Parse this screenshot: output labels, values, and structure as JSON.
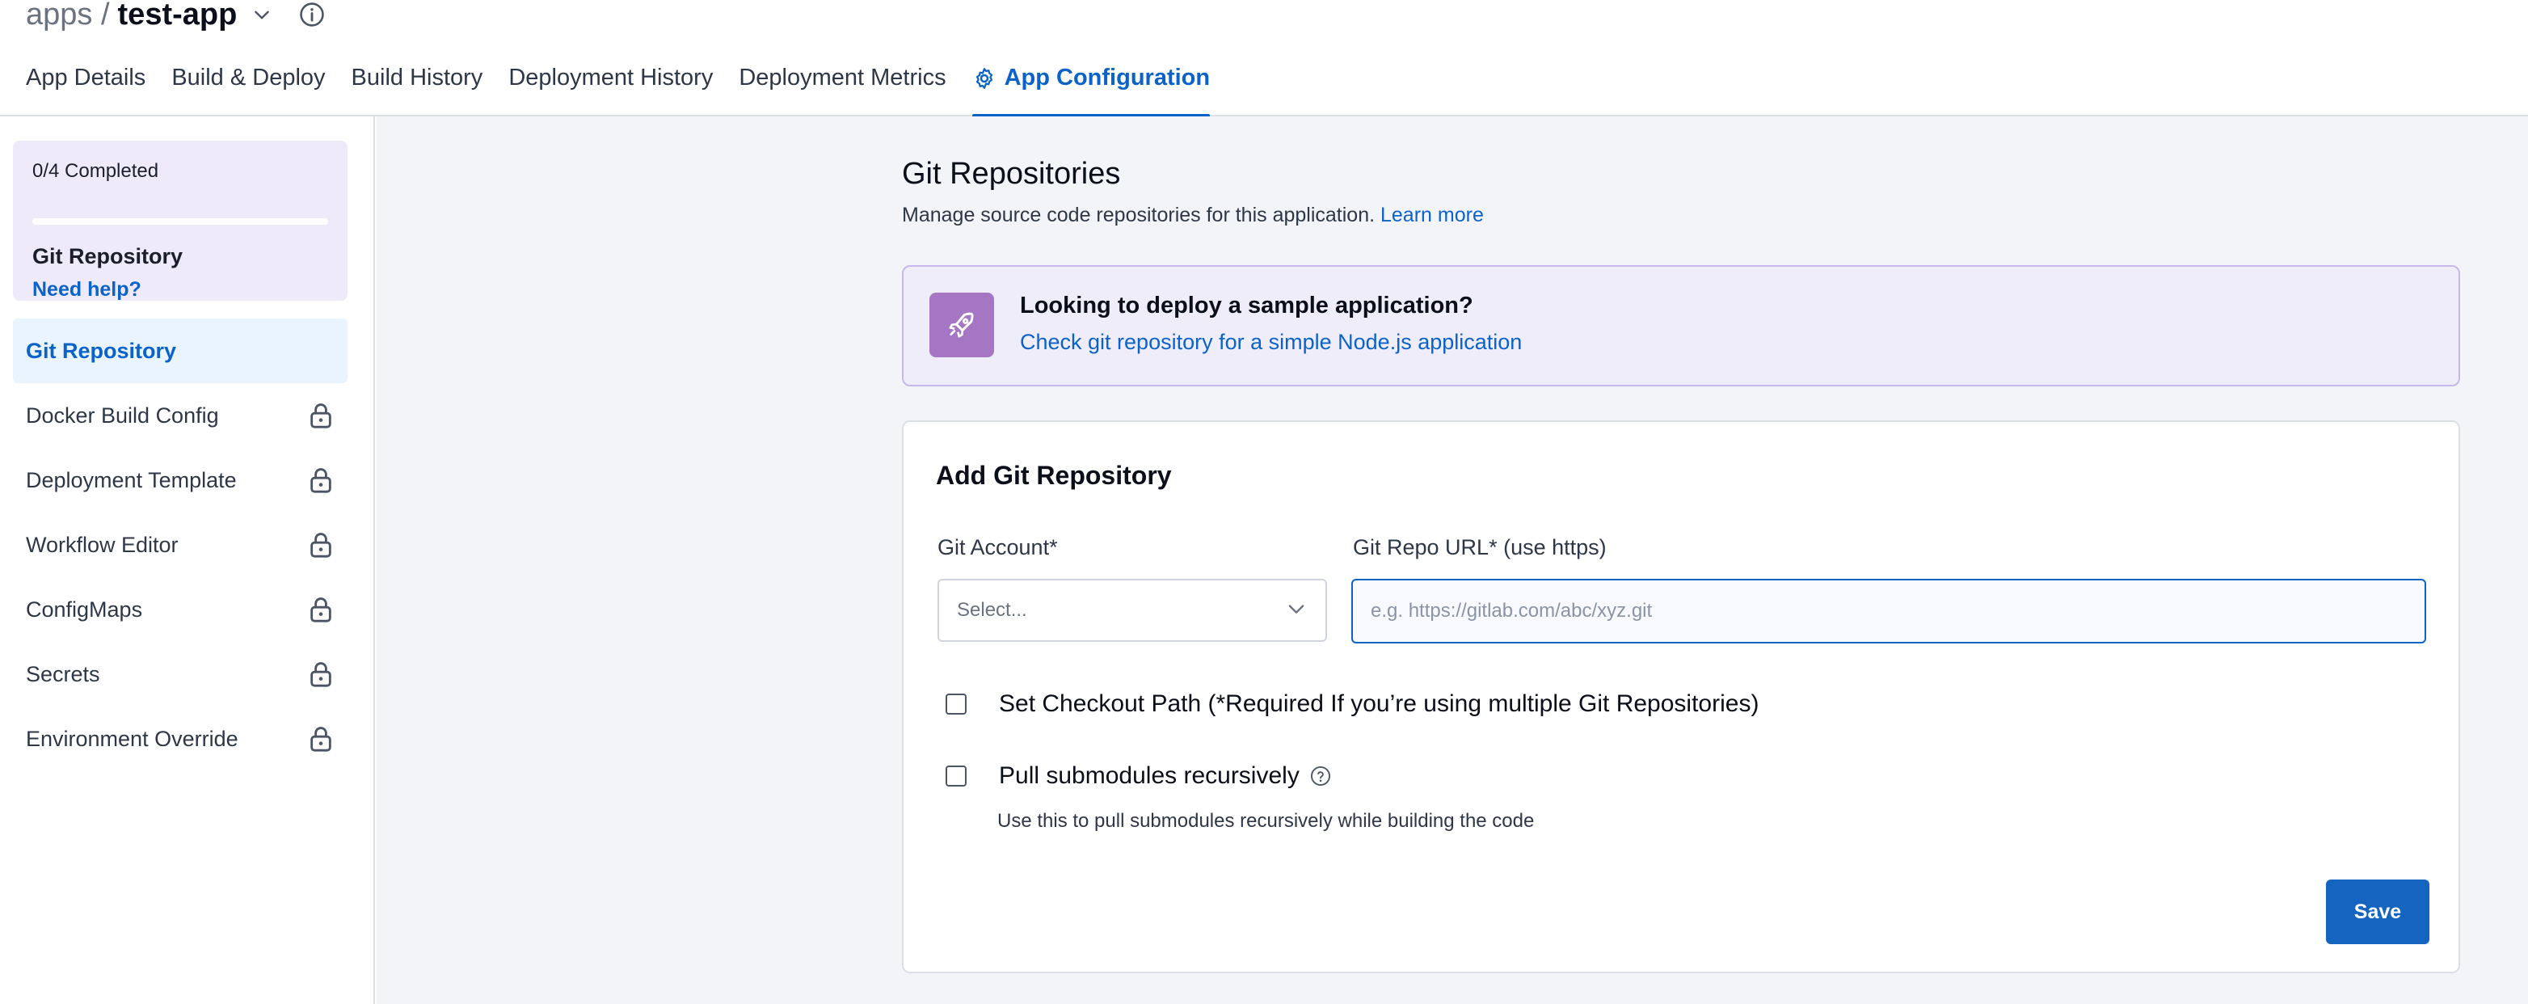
{
  "header": {
    "breadcrumb_root": "apps /",
    "app_name": "test-app"
  },
  "tabs": [
    {
      "label": "App Details"
    },
    {
      "label": "Build & Deploy"
    },
    {
      "label": "Build History"
    },
    {
      "label": "Deployment History"
    },
    {
      "label": "Deployment Metrics"
    },
    {
      "label": "App Configuration",
      "active": true
    }
  ],
  "sidebar": {
    "progress": {
      "label": "0/4 Completed",
      "fraction": 0,
      "current_step": "Git Repository",
      "help_link": "Need help?"
    },
    "items": [
      {
        "label": "Git Repository",
        "active": true,
        "locked": false
      },
      {
        "label": "Docker Build Config",
        "locked": true
      },
      {
        "label": "Deployment Template",
        "locked": true
      },
      {
        "label": "Workflow Editor",
        "locked": true
      },
      {
        "label": "ConfigMaps",
        "locked": true
      },
      {
        "label": "Secrets",
        "locked": true
      },
      {
        "label": "Environment Override",
        "locked": true
      }
    ]
  },
  "main": {
    "title": "Git Repositories",
    "description": "Manage source code repositories for this application.",
    "learn_more": "Learn more",
    "banner": {
      "icon": "rocket-icon",
      "title": "Looking to deploy a sample application?",
      "link": "Check git repository for a simple Node.js application"
    },
    "form": {
      "title": "Add Git Repository",
      "account_label": "Git Account*",
      "account_value": "Select...",
      "url_label": "Git Repo URL* (use https)",
      "url_placeholder": "e.g. https://gitlab.com/abc/xyz.git",
      "url_value": "",
      "checkout_label": "Set Checkout Path (*Required If you’re using multiple Git Repositories)",
      "checkout_checked": false,
      "submodules_label": "Pull submodules recursively",
      "submodules_checked": false,
      "submodules_hint": "Use this to pull submodules recursively while building the code",
      "save_label": "Save"
    }
  },
  "colors": {
    "accent": "#0b62c9",
    "banner_bg": "#f0edfb",
    "banner_icon_bg": "#a476c3",
    "main_bg": "#f2f4f7"
  }
}
